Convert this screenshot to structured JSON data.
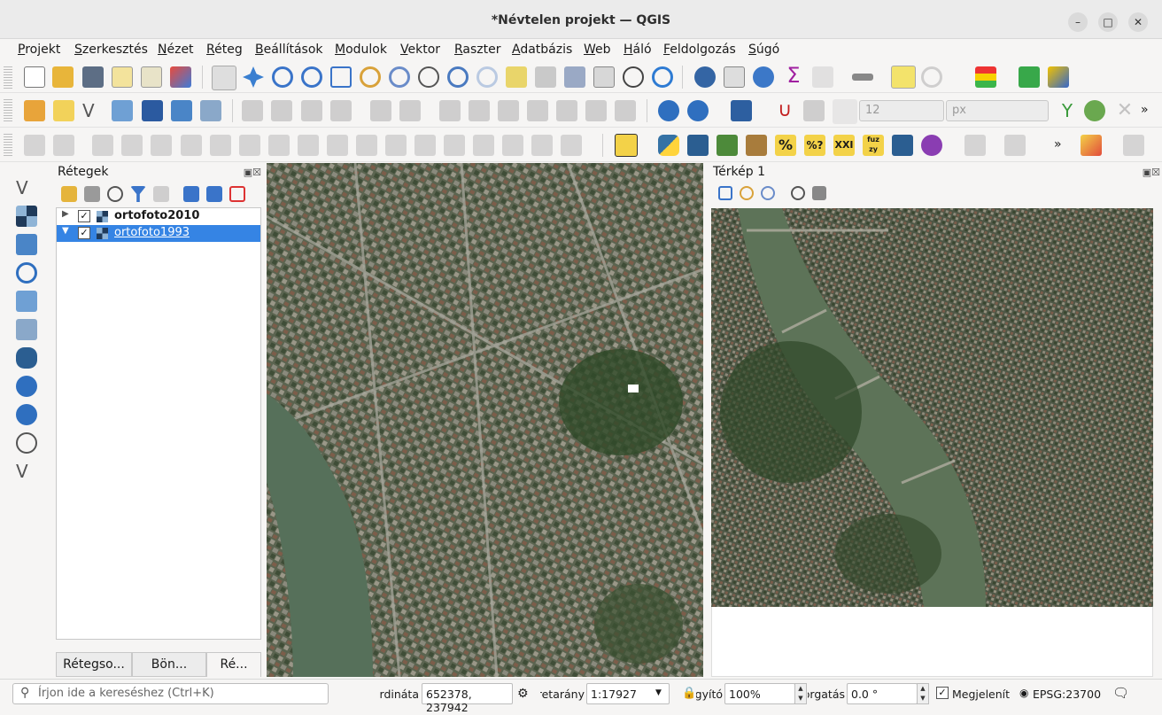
{
  "window": {
    "title": "*Névtelen projekt — QGIS"
  },
  "menu": [
    "Projekt",
    "Szerkesztés",
    "Nézet",
    "Réteg",
    "Beállítások",
    "Modulok",
    "Vektor",
    "Raszter",
    "Adatbázis",
    "Web",
    "Háló",
    "Feldolgozás",
    "Súgó"
  ],
  "toolbar": {
    "font_size_value": "12",
    "units_value": "px",
    "overflow": "»"
  },
  "layers": {
    "title": "Rétegek",
    "items": [
      {
        "name": "ortofoto2010",
        "checked": "✓"
      },
      {
        "name": "ortofoto1993",
        "checked": "✓"
      }
    ],
    "tabs": [
      "Rétegso...",
      "Bön...",
      "Ré..."
    ]
  },
  "map2": {
    "title": "Térkép 1"
  },
  "status": {
    "search_placeholder": "Írjon ide a kereséshez (Ctrl+K)",
    "coordinate_label": "Koordináta",
    "coordinate_value": "652378, 237942",
    "scale_label": "Méretarány",
    "scale_value": "1:17927",
    "magnifier_label": "Nagyító",
    "magnifier_value": "100%",
    "rotation_label": "Forgatás",
    "rotation_value": "0.0 °",
    "render_label": "Megjelenít",
    "render_checked": "✓",
    "crs": "EPSG:23700"
  }
}
